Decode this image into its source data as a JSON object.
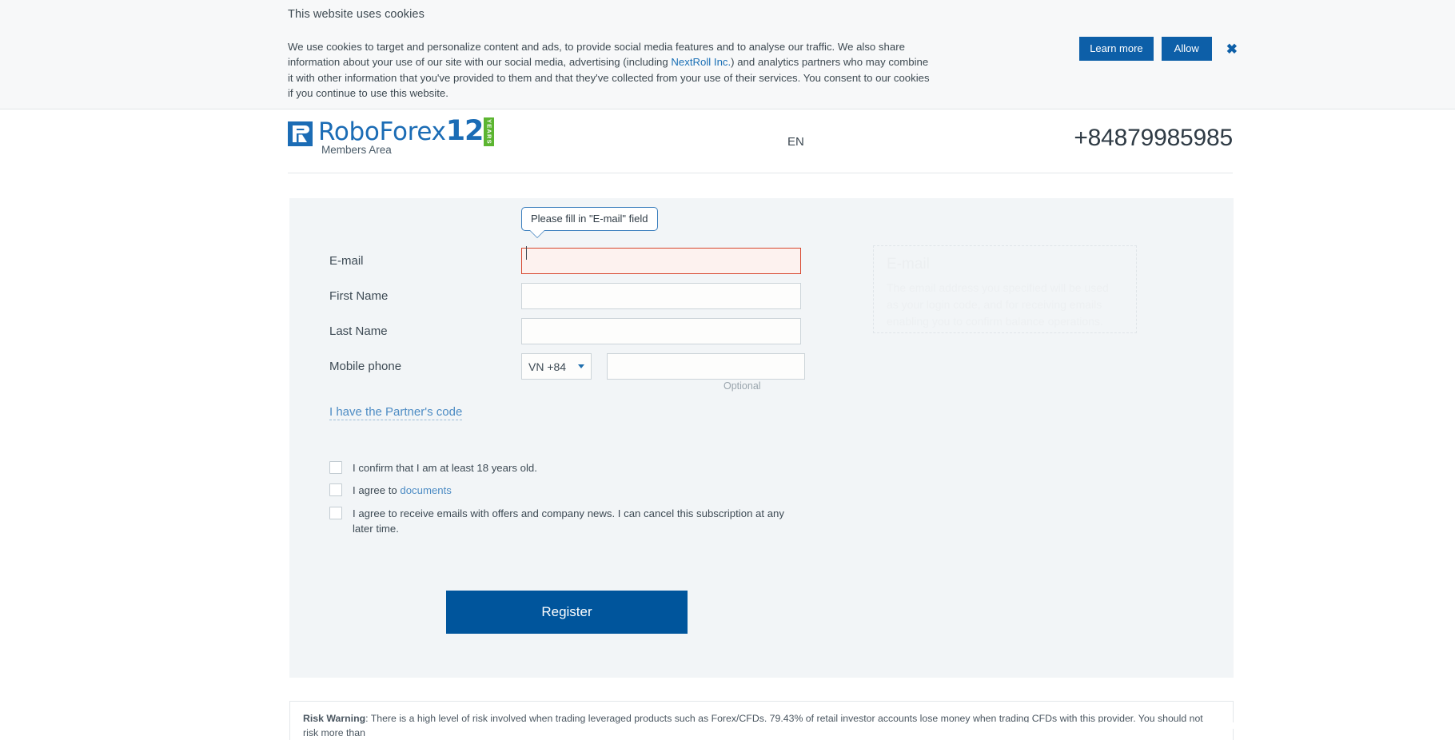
{
  "cookie_banner": {
    "title": "This website uses cookies",
    "body_part1": "We use cookies to target and personalize content and ads, to provide social media features and to analyse our traffic. We also share information about your use of our site with our social media, advertising (including ",
    "link_label": "NextRoll Inc.",
    "body_part2": ") and analytics partners who may combine it with other information that you've provided to them and that they've collected from your use of their services. You consent to our cookies if you continue to use this website.",
    "learn_more_label": "Learn more",
    "allow_label": "Allow",
    "close_label": "✖",
    "button_color": "#0d5fa8"
  },
  "header": {
    "logo_text": "RoboForex",
    "logo_anniversary": "12",
    "logo_years_badge": "YEARS",
    "subtitle": "Members Area",
    "language": "EN",
    "phone": "+84879985985",
    "brand_color": "#1b6cb5",
    "badge_color": "#5cb531"
  },
  "tooltip": {
    "message": "Please fill in \"E-mail\" field",
    "border_color": "#3a7ebd"
  },
  "form": {
    "fields": [
      {
        "label": "E-mail",
        "value": "",
        "placeholder": "",
        "state": "error"
      },
      {
        "label": "First Name",
        "value": "",
        "placeholder": "",
        "state": "normal"
      },
      {
        "label": "Last Name",
        "value": "",
        "placeholder": "",
        "state": "normal"
      },
      {
        "label": "Mobile phone",
        "value": "",
        "placeholder": "",
        "state": "normal"
      }
    ],
    "country_code": "VN +84",
    "optional_note": "Optional",
    "partner_code_link": "I have the Partner's code",
    "error_color": "#d6452c",
    "checkboxes": [
      {
        "text": "I confirm that I am at least 18 years old.",
        "checked": false
      },
      {
        "text_before": "I agree to ",
        "link": "documents",
        "text_after": "",
        "checked": false
      },
      {
        "text": "I agree to receive emails with offers and company news. I can cancel this subscription at any later time.",
        "checked": false
      }
    ],
    "submit_label": "Register",
    "submit_color": "#00559c"
  },
  "info_panel": {
    "title": "E-mail",
    "body": "The email address you specified will be used as your login code, and for receiving emails enabling you to confirm balance operations."
  },
  "footer": {
    "risk_label": "Risk Warning",
    "risk_text": ": There is a high level of risk involved when trading leveraged products such as Forex/CFDs. 79.43% of retail investor accounts lose money when trading CFDs with this provider. You should not risk more than"
  }
}
